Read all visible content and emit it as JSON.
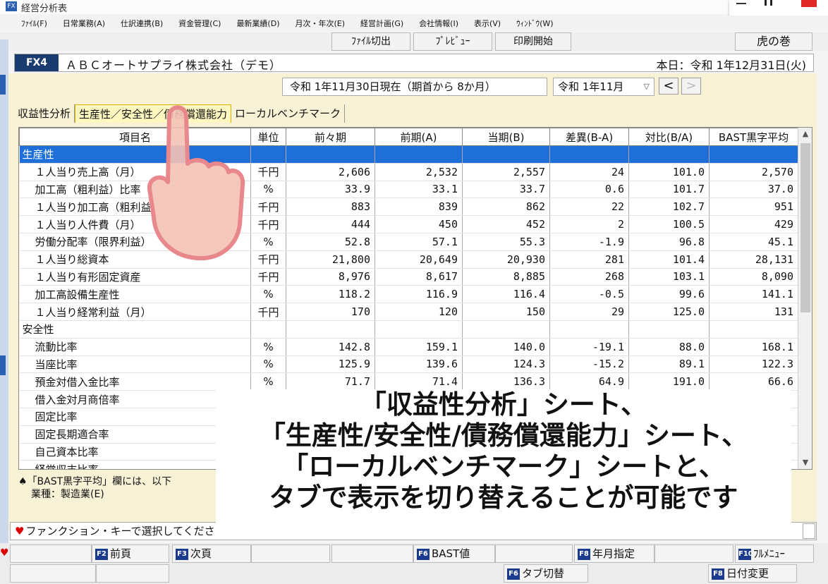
{
  "window": {
    "title": "経営分析表"
  },
  "menu": [
    "ﾌｧｲﾙ(F)",
    "日常業務(A)",
    "仕訳連携(B)",
    "資金管理(C)",
    "最新業績(D)",
    "月次・年次(E)",
    "経営計画(G)",
    "会社情報(I)",
    "表示(V)",
    "ｳｨﾝﾄﾞｳ(W)"
  ],
  "toolbar": {
    "file_export": "ﾌｧｲﾙ切出",
    "preview": "ﾌﾟﾚﾋﾞｭｰ",
    "print": "印刷開始",
    "tiger": "虎の巻"
  },
  "company": {
    "code": "FX4",
    "name": "ＡＢＣオートサプライ株式会社（デモ）",
    "today": "本日：令和 1年12月31日(火)"
  },
  "period": {
    "as_of": "令和 1年11月30日現在（期首から 8か月）",
    "month": "令和 1年11月",
    "prev": "<",
    "next": ">"
  },
  "tabs": [
    "収益性分析",
    "生産性／安全性／債務償還能力",
    "ローカルベンチマーク"
  ],
  "table": {
    "headers": [
      "項目名",
      "単位",
      "前々期",
      "前期(A)",
      "当期(B)",
      "差異(B-A)",
      "対比(B/A)",
      "BAST黒字平均"
    ],
    "rows": [
      {
        "name": "生産性",
        "section": true,
        "selected": true,
        "unit": "",
        "v": [
          "",
          "",
          "",
          "",
          "",
          ""
        ]
      },
      {
        "name": "１人当り売上高（月）",
        "unit": "千円",
        "v": [
          "2,606",
          "2,532",
          "2,557",
          "24",
          "101.0",
          "2,570"
        ]
      },
      {
        "name": "加工高（粗利益）比率",
        "unit": "%",
        "v": [
          "33.9",
          "33.1",
          "33.7",
          "0.6",
          "101.7",
          "37.0"
        ]
      },
      {
        "name": "１人当り加工高（粗利益）",
        "unit": "千円",
        "v": [
          "883",
          "839",
          "862",
          "22",
          "102.7",
          "951"
        ]
      },
      {
        "name": "１人当り人件費（月）",
        "unit": "千円",
        "v": [
          "444",
          "450",
          "452",
          "2",
          "100.5",
          "429"
        ]
      },
      {
        "name": "労働分配率（限界利益）",
        "unit": "%",
        "v": [
          "52.8",
          "57.1",
          "55.3",
          "-1.9",
          "96.8",
          "45.1"
        ]
      },
      {
        "name": "１人当り総資本",
        "unit": "千円",
        "v": [
          "21,800",
          "20,649",
          "20,930",
          "281",
          "101.4",
          "28,131"
        ]
      },
      {
        "name": "１人当り有形固定資産",
        "unit": "千円",
        "v": [
          "8,976",
          "8,617",
          "8,885",
          "268",
          "103.1",
          "8,090"
        ]
      },
      {
        "name": "加工高設備生産性",
        "unit": "%",
        "v": [
          "118.2",
          "116.9",
          "116.4",
          "-0.5",
          "99.6",
          "141.1"
        ]
      },
      {
        "name": "１人当り経常利益（月）",
        "unit": "千円",
        "v": [
          "170",
          "120",
          "150",
          "29",
          "125.0",
          "131"
        ]
      },
      {
        "name": "安全性",
        "section": true,
        "unit": "",
        "v": [
          "",
          "",
          "",
          "",
          "",
          ""
        ]
      },
      {
        "name": "流動比率",
        "unit": "%",
        "v": [
          "142.8",
          "159.1",
          "140.0",
          "-19.1",
          "88.0",
          "168.1"
        ]
      },
      {
        "name": "当座比率",
        "unit": "%",
        "v": [
          "125.9",
          "139.6",
          "124.3",
          "-15.2",
          "89.1",
          "122.3"
        ]
      },
      {
        "name": "預金対借入金比率",
        "unit": "%",
        "v": [
          "71.7",
          "71.4",
          "136.3",
          "64.9",
          "191.0",
          "66.6"
        ]
      },
      {
        "name": "借入金対月商倍率",
        "unit": "",
        "v": [
          "",
          "",
          "",
          "",
          "",
          ""
        ]
      },
      {
        "name": "固定比率",
        "unit": "",
        "v": [
          "",
          "",
          "",
          "",
          "",
          ""
        ]
      },
      {
        "name": "固定長期適合率",
        "unit": "",
        "v": [
          "",
          "",
          "",
          "",
          "",
          ""
        ]
      },
      {
        "name": "自己資本比率",
        "unit": "",
        "v": [
          "",
          "",
          "",
          "",
          "",
          ""
        ]
      },
      {
        "name": "経常収支比率",
        "unit": "",
        "v": [
          "",
          "",
          "",
          "",
          "",
          ""
        ]
      }
    ]
  },
  "note": {
    "line1": "♠「BAST黒字平均」欄には、以下",
    "line2": "業種：製造業(E)"
  },
  "status": "ファンクション・キーで選択してください。",
  "fkeys": {
    "f2": {
      "key": "F2",
      "label": "前頁"
    },
    "f3": {
      "key": "F3",
      "label": "次頁"
    },
    "f6": {
      "key": "F6",
      "label": "BAST値"
    },
    "f8": {
      "key": "F8",
      "label": "年月指定"
    },
    "f10": {
      "key": "F10",
      "label": "ﾌﾙﾒﾆｭｰ"
    },
    "f6b": {
      "key": "F6",
      "label": "タブ切替"
    },
    "f8b": {
      "key": "F8",
      "label": "日付変更"
    }
  },
  "caption": [
    "「収益性分析」シート、",
    "「生産性/安全性/債務償還能力」シート、",
    "「ローカルベンチマーク」シートと、",
    "タブで表示を切り替えることが可能です"
  ],
  "colors": {
    "selection": "#1e6fd8",
    "company_badge": "#1a3b6e",
    "content_bg": "#f7f1d6"
  }
}
